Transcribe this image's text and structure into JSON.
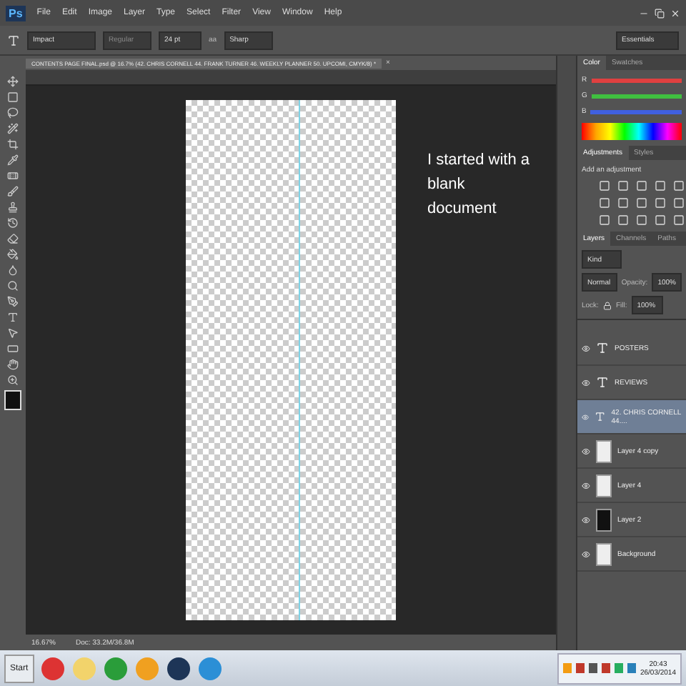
{
  "app_logo": "Ps",
  "menu": [
    "File",
    "Edit",
    "Image",
    "Layer",
    "Type",
    "Select",
    "Filter",
    "View",
    "Window",
    "Help"
  ],
  "options_bar": {
    "font_family": "Impact",
    "font_style": "Regular",
    "font_size": "24 pt",
    "aa_label": "aa",
    "antialias": "Sharp",
    "workspace": "Essentials"
  },
  "document_tab": {
    "title": "CONTENTS PAGE FINAL.psd @ 16.7% (42. CHRIS CORNELL 44. FRANK TURNER 46. WEEKLY PLANNER 50. UPCOMI, CMYK/8) *",
    "close": "×"
  },
  "canvas_note": "I started with a blank document",
  "color_panel": {
    "tabs": [
      {
        "label": "Color",
        "selected": true
      },
      {
        "label": "Swatches",
        "selected": false
      }
    ],
    "channels": [
      {
        "name": "R",
        "color": "#e04040"
      },
      {
        "name": "G",
        "color": "#40c040"
      },
      {
        "name": "B",
        "color": "#4060e0"
      }
    ]
  },
  "adjustments_panel": {
    "tabs": [
      {
        "label": "Adjustments",
        "selected": true
      },
      {
        "label": "Styles",
        "selected": false
      }
    ],
    "heading": "Add an adjustment"
  },
  "layers_panel": {
    "tabs": [
      {
        "label": "Layers",
        "selected": true
      },
      {
        "label": "Channels",
        "selected": false
      },
      {
        "label": "Paths",
        "selected": false
      }
    ],
    "filter": "Kind",
    "blend_mode": "Normal",
    "opacity_label": "Opacity:",
    "opacity": "100%",
    "lock_label": "Lock:",
    "fill_label": "Fill:",
    "fill": "100%",
    "layers": [
      {
        "kind": "text",
        "name": "POSTERS",
        "selected": false
      },
      {
        "kind": "text",
        "name": "REVIEWS",
        "selected": false
      },
      {
        "kind": "text",
        "name": "42. CHRIS CORNELL 44....",
        "selected": true
      },
      {
        "kind": "image",
        "name": "Layer 4 copy",
        "selected": false
      },
      {
        "kind": "image",
        "name": "Layer 4",
        "selected": false
      },
      {
        "kind": "image",
        "name": "Layer 2",
        "selected": false
      },
      {
        "kind": "image",
        "name": "Background",
        "selected": false
      }
    ]
  },
  "status_bar": {
    "zoom": "16.67%",
    "doc": "Doc: 33.2M/36.8M"
  },
  "taskbar": {
    "start": "Start",
    "time": "20:43",
    "date": "26/03/2014"
  }
}
